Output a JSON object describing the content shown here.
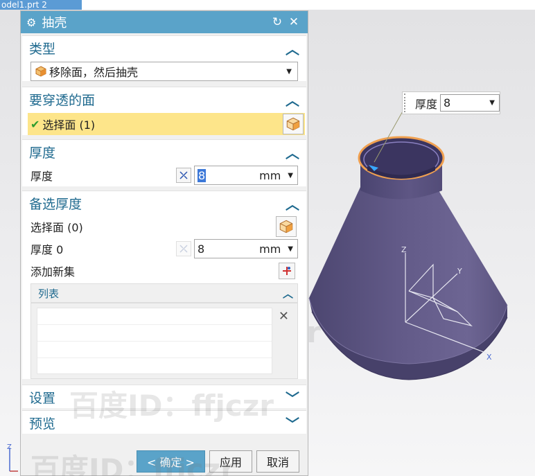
{
  "file_tab": {
    "label": "odel1.prt 2"
  },
  "dialog": {
    "title": "抽壳",
    "reset_label": "↻",
    "close_label": "✕"
  },
  "sections": {
    "type": {
      "title": "类型",
      "selected": "移除面，然后抽壳"
    },
    "faces_to_pierce": {
      "title": "要穿透的面",
      "select_label": "选择面 (1)"
    },
    "thickness": {
      "title": "厚度",
      "label": "厚度",
      "value": "8",
      "unit": "mm"
    },
    "alt_thickness": {
      "title": "备选厚度",
      "select_label": "选择面 (0)",
      "thickness_label": "厚度 0",
      "thickness_value": "8",
      "thickness_unit": "mm",
      "add_set_label": "添加新集",
      "list_title": "列表"
    },
    "settings": {
      "title": "设置"
    },
    "preview": {
      "title": "预览"
    }
  },
  "buttons": {
    "ok": "< 确定 >",
    "apply": "应用",
    "cancel": "取消"
  },
  "callout": {
    "label": "厚度",
    "value": "8"
  },
  "axes": {
    "x": "X",
    "y": "Y",
    "z": "Z"
  },
  "watermark": "百度ID：ffjczr",
  "colors": {
    "title_bar": "#5aa3c9",
    "section_title": "#1f6a8f",
    "selection_highlight": "#fde58a",
    "model_body": "#5e5680"
  }
}
